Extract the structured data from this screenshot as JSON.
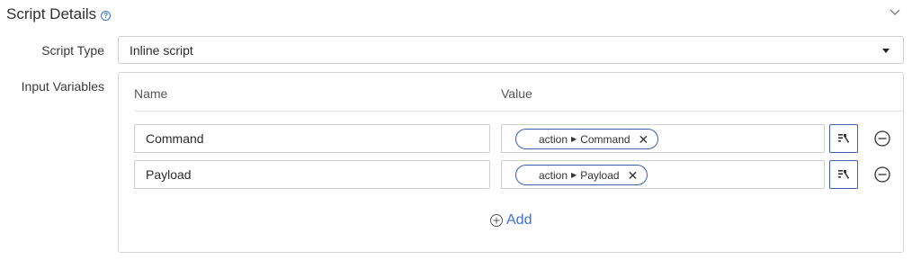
{
  "section": {
    "title": "Script Details",
    "help_icon": "question-circle-icon",
    "collapse_icon": "chevron-down-icon"
  },
  "script_type": {
    "label": "Script Type",
    "value": "Inline script"
  },
  "input_variables": {
    "label": "Input Variables",
    "columns": {
      "name": "Name",
      "value": "Value"
    },
    "rows": [
      {
        "name": "Command",
        "token_source": "action",
        "token_field": "Command"
      },
      {
        "name": "Payload",
        "token_source": "action",
        "token_field": "Payload"
      }
    ],
    "add_label": "Add"
  },
  "colors": {
    "accent": "#3b6fd6",
    "token_border": "#3b5fa8",
    "border": "#cfcfcf"
  }
}
